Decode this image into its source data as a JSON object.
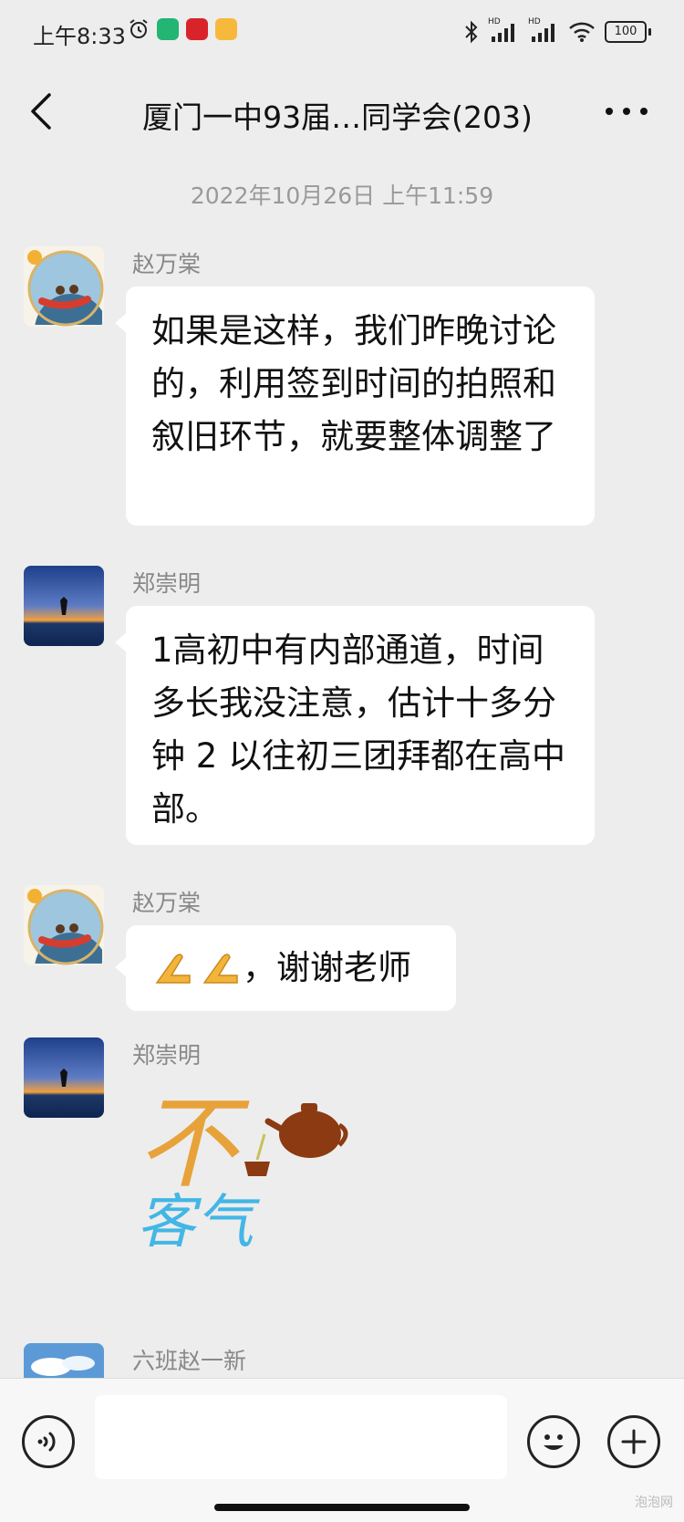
{
  "status_bar": {
    "time": "上午8:33",
    "battery": "100",
    "hd_label": "HD",
    "hd_label_2": "HD"
  },
  "nav": {
    "title": "厦门一中93届…同学会(203)"
  },
  "timestamp": "2022年10月26日 上午11:59",
  "messages": [
    {
      "sender": "赵万棠",
      "text": "如果是这样，我们昨晚讨论的，利用签到时间的拍照和叙旧环节，就要整体调整了"
    },
    {
      "sender": "郑崇明",
      "text": "1高初中有内部通道，时间多长我没注意，估计十多分钟 2 以往初三团拜都在高中部。"
    },
    {
      "sender": "赵万棠",
      "text": "，谢谢老师"
    },
    {
      "sender": "郑崇明",
      "sticker_text_1": "不",
      "sticker_text_2": "客气"
    },
    {
      "sender": "六班赵一新"
    }
  ],
  "input": {
    "value": "",
    "placeholder": ""
  },
  "watermark": "泡泡网"
}
